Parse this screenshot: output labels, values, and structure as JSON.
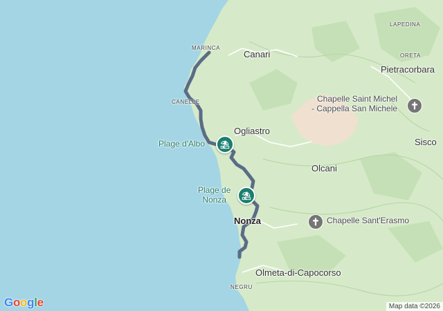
{
  "map": {
    "towns": {
      "canari": "Canari",
      "pietracorbara": "Pietracorbara",
      "ogliastro": "Ogliastro",
      "olcani": "Olcani",
      "sisco": "Sisco",
      "nonza": "Nonza",
      "olmeta": "Olmeta-di-Capocorso"
    },
    "hamlets": {
      "marinca": "MARINCA",
      "canelle": "CANELLE",
      "lapedina": "LAPEDINA",
      "oreta": "ORETA",
      "negru": "NEGRU"
    },
    "pois": {
      "chapelle_michel_line1": "Chapelle Saint Michel",
      "chapelle_michel_line2": "- Cappella San Michele",
      "chapelle_erasmo": "Chapelle Sant'Erasmo"
    },
    "beaches": {
      "albo": "Plage d'Albo",
      "nonza_line1": "Plage de",
      "nonza_line2": "Nonza"
    },
    "icons": {
      "beach": "beach-umbrella-icon",
      "chapel": "chapel-cross-icon"
    },
    "colors": {
      "sea": "#a3d5e4",
      "land": "#d6eac9",
      "route": "#5b6c86",
      "beach_pin": "#1a7f6e",
      "chapel_pin": "#757575"
    }
  },
  "branding": {
    "logo": "Google",
    "attribution": "Map data ©2026"
  }
}
